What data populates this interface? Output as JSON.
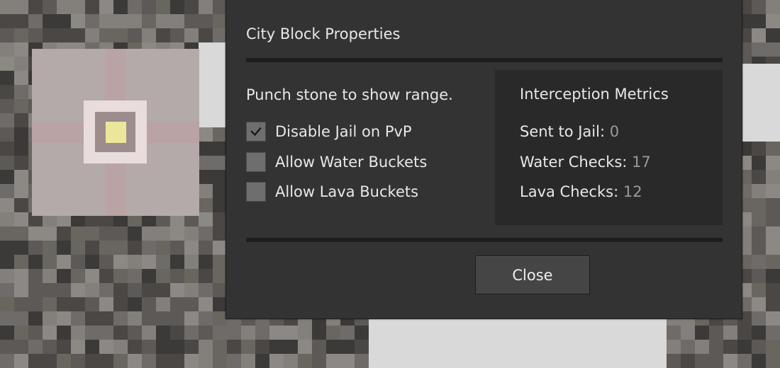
{
  "dialog": {
    "title": "City Block Properties",
    "hint": "Punch stone to show range.",
    "options": [
      {
        "label": "Disable Jail on PvP",
        "checked": true
      },
      {
        "label": "Allow Water Buckets",
        "checked": false
      },
      {
        "label": "Allow Lava Buckets",
        "checked": false
      }
    ],
    "metrics": {
      "title": "Interception Metrics",
      "items": [
        {
          "label": "Sent to Jail:",
          "value": "0"
        },
        {
          "label": "Water Checks:",
          "value": "17"
        },
        {
          "label": "Lava Checks:",
          "value": "12"
        }
      ]
    },
    "close_label": "Close"
  },
  "colors": {
    "dialog_bg": "#333333",
    "metrics_bg": "#292929",
    "checkbox_bg": "#6e6e6e",
    "value_text": "#9a9a9a"
  }
}
